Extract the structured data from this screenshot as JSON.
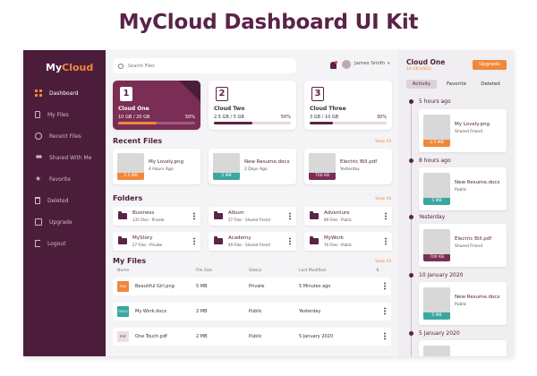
{
  "page_title": "MyCloud Dashboard UI Kit",
  "logo": {
    "my": "My",
    "cloud": "Cloud"
  },
  "sidebar": {
    "items": [
      {
        "label": "Dashboard",
        "icon": "dashboard-grid-icon",
        "active": true
      },
      {
        "label": "My Files",
        "icon": "file-icon"
      },
      {
        "label": "Recent Files",
        "icon": "clock-icon"
      },
      {
        "label": "Shared With Me",
        "icon": "users-icon"
      },
      {
        "label": "Favorite",
        "icon": "star-icon"
      },
      {
        "label": "Deleted",
        "icon": "trash-icon"
      },
      {
        "label": "Upgrade",
        "icon": "upgrade-icon"
      },
      {
        "label": "Logout",
        "icon": "logout-icon"
      }
    ]
  },
  "header": {
    "search_placeholder": "Search Files",
    "user_name": "James Smith",
    "chevron": "▾"
  },
  "clouds": [
    {
      "num": "1",
      "name": "Cloud One",
      "size": "10 GB / 20 GB",
      "percent_label": "50%",
      "percent": 50
    },
    {
      "num": "2",
      "name": "Cloud Two",
      "size": "2.5 GB / 5 GB",
      "percent_label": "50%",
      "percent": 50
    },
    {
      "num": "3",
      "name": "Cloud Three",
      "size": "3 GB / 10 GB",
      "percent_label": "30%",
      "percent": 30
    }
  ],
  "recent": {
    "title": "Recent Files",
    "view_all": "View All",
    "files": [
      {
        "name": "My Lovely.png",
        "time": "4 Hours Ago",
        "size": "2.5 MB",
        "color": "#f0883a"
      },
      {
        "name": "New Resume.docx",
        "time": "2 Days Ago",
        "size": "5 MB",
        "color": "#3aa7a0"
      },
      {
        "name": "Electric Bill.pdf",
        "time": "Yesterday",
        "size": "700 KB",
        "color": "#7a2e55"
      }
    ]
  },
  "folders": {
    "title": "Folders",
    "view_all": "View All",
    "items": [
      {
        "name": "Business",
        "meta": "135 Files - Private"
      },
      {
        "name": "Album",
        "meta": "57 Files - Shared Friend"
      },
      {
        "name": "Adventure",
        "meta": "89 Files - Public"
      },
      {
        "name": "MyStory",
        "meta": "27 Files - Private"
      },
      {
        "name": "Academy",
        "meta": "49 Files - Shared Friend"
      },
      {
        "name": "MyWork",
        "meta": "76 Files - Public"
      }
    ]
  },
  "my_files": {
    "title": "My Files",
    "view_all": "View All",
    "columns": {
      "name": "Name",
      "size": "File Size",
      "status": "Status",
      "modified": "Last Modified",
      "sort": "⇅"
    },
    "rows": [
      {
        "badge": "PNG",
        "name": "Beautiful Girl.png",
        "size": "5 MB",
        "status": "Private",
        "modified": "5 Minutes ago",
        "badge_bg": "#f0883a",
        "badge_fg": "#ffffff"
      },
      {
        "badge": "DOCX",
        "name": "My Work.docx",
        "size": "2 MB",
        "status": "Public",
        "modified": "Yesterday",
        "badge_bg": "#3aa7a0",
        "badge_fg": "#ffffff"
      },
      {
        "badge": "PDF",
        "name": "One Touch.pdf",
        "size": "2 MB",
        "status": "Public",
        "modified": "5 January 2020",
        "badge_bg": "#eadfe6",
        "badge_fg": "#5a2347"
      }
    ]
  },
  "panel": {
    "title": "Cloud One",
    "used": "10 GB USED",
    "upgrade": "Upgrade",
    "tabs": [
      "Activity",
      "Favorite",
      "Deleted"
    ],
    "timeline": [
      {
        "label": "5 hours ago",
        "file": "My Lovely.png",
        "who": "Shared Friend",
        "size": "2.5 MB",
        "color": "#f0883a"
      },
      {
        "label": "8 hours ago",
        "file": "New Resume.docx",
        "who": "Public",
        "size": "5 MB",
        "color": "#3aa7a0"
      },
      {
        "label": "Yesterday",
        "file": "Electric Bill.pdf",
        "who": "Shared Friend",
        "size": "700 KB",
        "color": "#7a2e55"
      },
      {
        "label": "10 January 2020",
        "file": "New Resume.docx",
        "who": "Public",
        "size": "5 MB",
        "color": "#3aa7a0"
      },
      {
        "label": "5 January 2020"
      }
    ]
  },
  "colors": {
    "primary": "#4c1d3b",
    "accent": "#f0883a",
    "teal": "#3aa7a0"
  }
}
